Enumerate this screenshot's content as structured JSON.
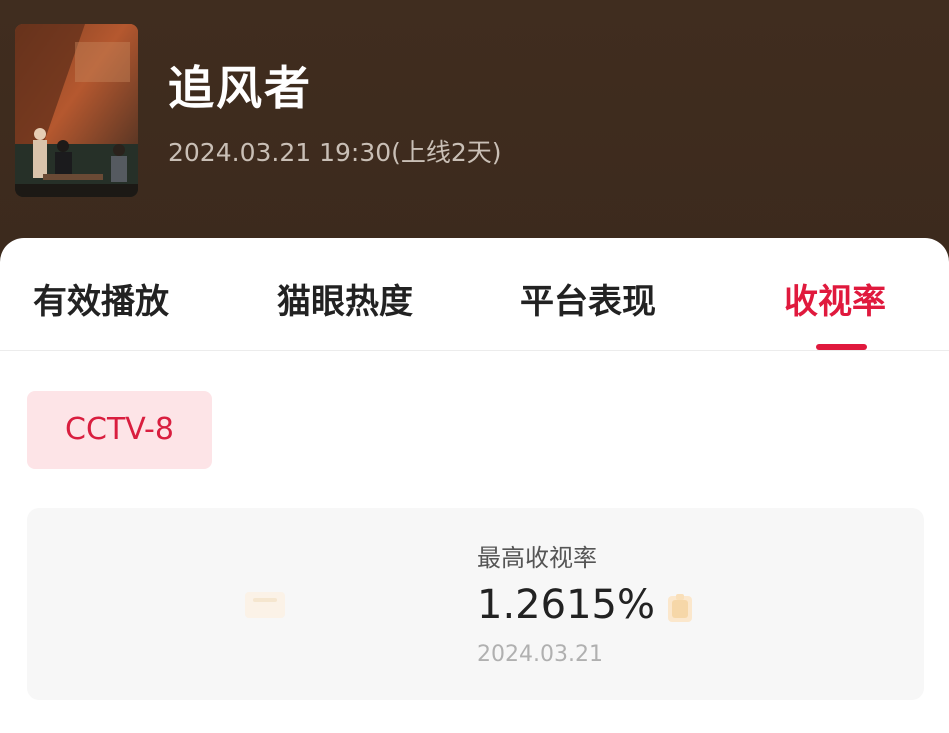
{
  "drama": {
    "title": "追风者",
    "release": "2024.03.21 19:30(上线2天)"
  },
  "tabs": [
    {
      "label": "有效播放",
      "active": false
    },
    {
      "label": "猫眼热度",
      "active": false
    },
    {
      "label": "平台表现",
      "active": false
    },
    {
      "label": "收视率",
      "active": true
    }
  ],
  "channel": {
    "label": "CCTV-8"
  },
  "stat": {
    "label": "最高收视率",
    "value": "1.2615%",
    "date": "2024.03.21"
  },
  "colors": {
    "header_bg": "#3e2c1f",
    "accent": "#e0193d",
    "chip_bg": "#fde4e7"
  }
}
